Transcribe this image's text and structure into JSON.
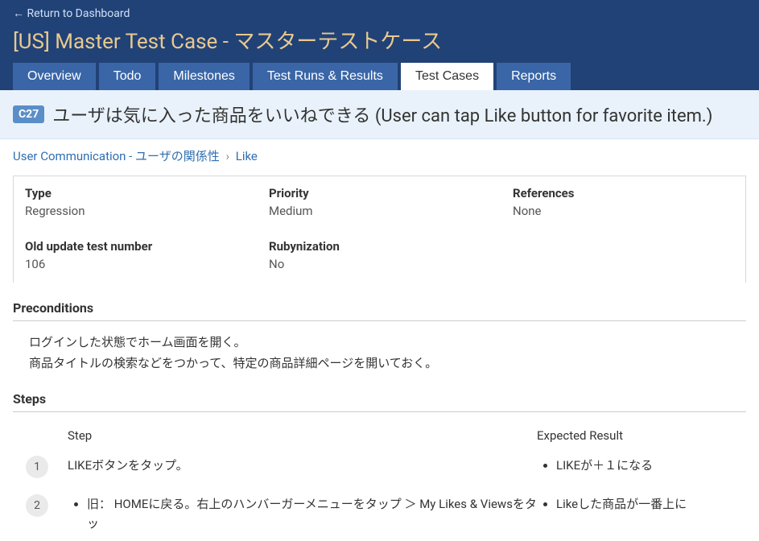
{
  "header": {
    "return_label": "← Return to Dashboard",
    "title": "[US] Master Test Case - マスターテストケース"
  },
  "tabs": {
    "overview": "Overview",
    "todo": "Todo",
    "milestones": "Milestones",
    "testruns": "Test Runs & Results",
    "testcases": "Test Cases",
    "reports": "Reports"
  },
  "case": {
    "badge": "C27",
    "title": "ユーザは気に入った商品をいいねできる (User can tap Like button for favorite item.)"
  },
  "breadcrumb": {
    "section": "User Communication - ユーザの関係性",
    "sep": "›",
    "subsection": "Like"
  },
  "details": {
    "type_label": "Type",
    "type_value": "Regression",
    "priority_label": "Priority",
    "priority_value": "Medium",
    "references_label": "References",
    "references_value": "None",
    "oldnum_label": "Old update test number",
    "oldnum_value": "106",
    "rubynization_label": "Rubynization",
    "rubynization_value": "No"
  },
  "preconditions": {
    "heading": "Preconditions",
    "line1": "ログインした状態でホーム画面を開く。",
    "line2": "商品タイトルの検索などをつかって、特定の商品詳細ページを開いておく。"
  },
  "steps": {
    "heading": "Steps",
    "col_step": "Step",
    "col_expected": "Expected Result",
    "rows": [
      {
        "num": "1",
        "content": "LIKEボタンをタップ。",
        "expected_item": "LIKEが＋１になる"
      },
      {
        "num": "2",
        "content_item": "旧： HOMEに戻る。右上のハンバーガーメニューをタップ ＞ My Likes & Viewsをタッ",
        "expected_item": "Likeした商品が一番上に"
      }
    ]
  }
}
